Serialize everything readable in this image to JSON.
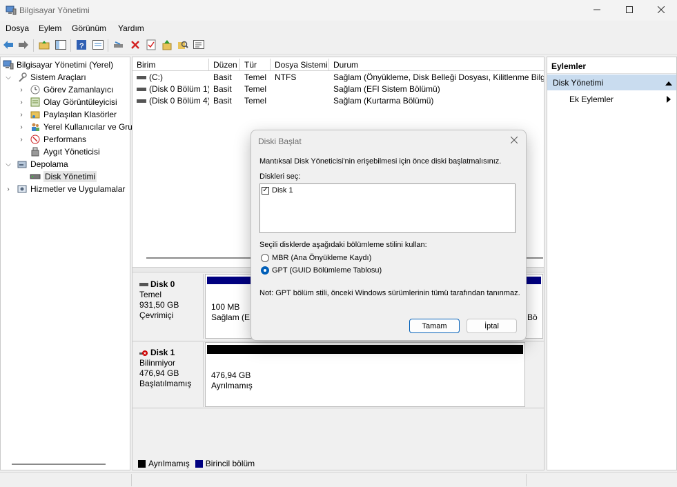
{
  "window": {
    "title": "Bilgisayar Yönetimi",
    "controls": [
      "minimize-icon",
      "maximize-icon",
      "close-icon"
    ]
  },
  "menu": [
    "Dosya",
    "Eylem",
    "Görünüm",
    "Yardım"
  ],
  "toolbar_icons": [
    "back-arrow-icon",
    "forward-arrow-icon",
    "up-folder-icon",
    "show-hide-tree-icon",
    "help-icon",
    "properties-icon",
    "connect-drive-icon",
    "delete-icon",
    "check-icon",
    "export-icon",
    "search-icon",
    "console-icon"
  ],
  "tree": {
    "root": "Bilgisayar Yönetimi (Yerel)",
    "items": [
      {
        "label": "Sistem Araçları",
        "level": 1,
        "expanded": true
      },
      {
        "label": "Görev Zamanlayıcı",
        "level": 2
      },
      {
        "label": "Olay Görüntüleyicisi",
        "level": 2
      },
      {
        "label": "Paylaşılan Klasörler",
        "level": 2
      },
      {
        "label": "Yerel Kullanıcılar ve Gru",
        "level": 2
      },
      {
        "label": "Performans",
        "level": 2
      },
      {
        "label": "Aygıt Yöneticisi",
        "level": 2
      },
      {
        "label": "Depolama",
        "level": 1,
        "expanded": true
      },
      {
        "label": "Disk Yönetimi",
        "level": 2,
        "selected": true
      },
      {
        "label": "Hizmetler ve Uygulamalar",
        "level": 1
      }
    ]
  },
  "volumes": {
    "columns": [
      "Birim",
      "Düzen",
      "Tür",
      "Dosya Sistemi",
      "Durum"
    ],
    "rows": [
      [
        "(C:)",
        "Basit",
        "Temel",
        "NTFS",
        "Sağlam (Önyükleme, Disk Belleği Dosyası, Kilitlenme Bilgis"
      ],
      [
        "(Disk 0 Bölüm 1)",
        "Basit",
        "Temel",
        "",
        "Sağlam (EFI Sistem Bölümü)"
      ],
      [
        "(Disk 0 Bölüm 4)",
        "Basit",
        "Temel",
        "",
        "Sağlam (Kurtarma Bölümü)"
      ]
    ]
  },
  "disks": [
    {
      "name": "Disk 0",
      "type": "Temel",
      "size": "931,50 GB",
      "status": "Çevrimiçi",
      "partition_size": "100 MB",
      "partition_status": "Sağlam (EF",
      "partition_tail": "Bö"
    },
    {
      "name": "Disk 1",
      "type": "Bilinmiyor",
      "size": "476,94 GB",
      "status": "Başlatılmamış",
      "partition_size": "476,94 GB",
      "partition_status": "Ayrılmamış"
    }
  ],
  "legend": [
    {
      "label": "Ayrılmamış",
      "color": "#000000"
    },
    {
      "label": "Birincil bölüm",
      "color": "#000080"
    }
  ],
  "actions": {
    "header": "Eylemler",
    "selected": "Disk Yönetimi",
    "sub": "Ek Eylemler"
  },
  "dialog": {
    "title": "Diski Başlat",
    "intro": "Mantıksal Disk Yöneticisi'nin erişebilmesi için önce diski başlatmalısınız.",
    "select_label": "Diskleri seç:",
    "disk_item": "Disk 1",
    "disk_checked": true,
    "style_label": "Seçili disklerde aşağıdaki bölümleme stilini kullan:",
    "option_mbr": "MBR (Ana Önyükleme Kaydı)",
    "option_gpt": "GPT (GUID Bölümleme Tablosu)",
    "selected_option": "GPT",
    "note": "Not: GPT bölüm stili, önceki Windows sürümlerinin tümü tarafından tanınmaz.",
    "ok": "Tamam",
    "cancel": "İptal"
  },
  "colors": {
    "accent": "#005fb8",
    "selection": "#c9dcef",
    "primary_partition": "#000080",
    "unallocated": "#000000"
  }
}
